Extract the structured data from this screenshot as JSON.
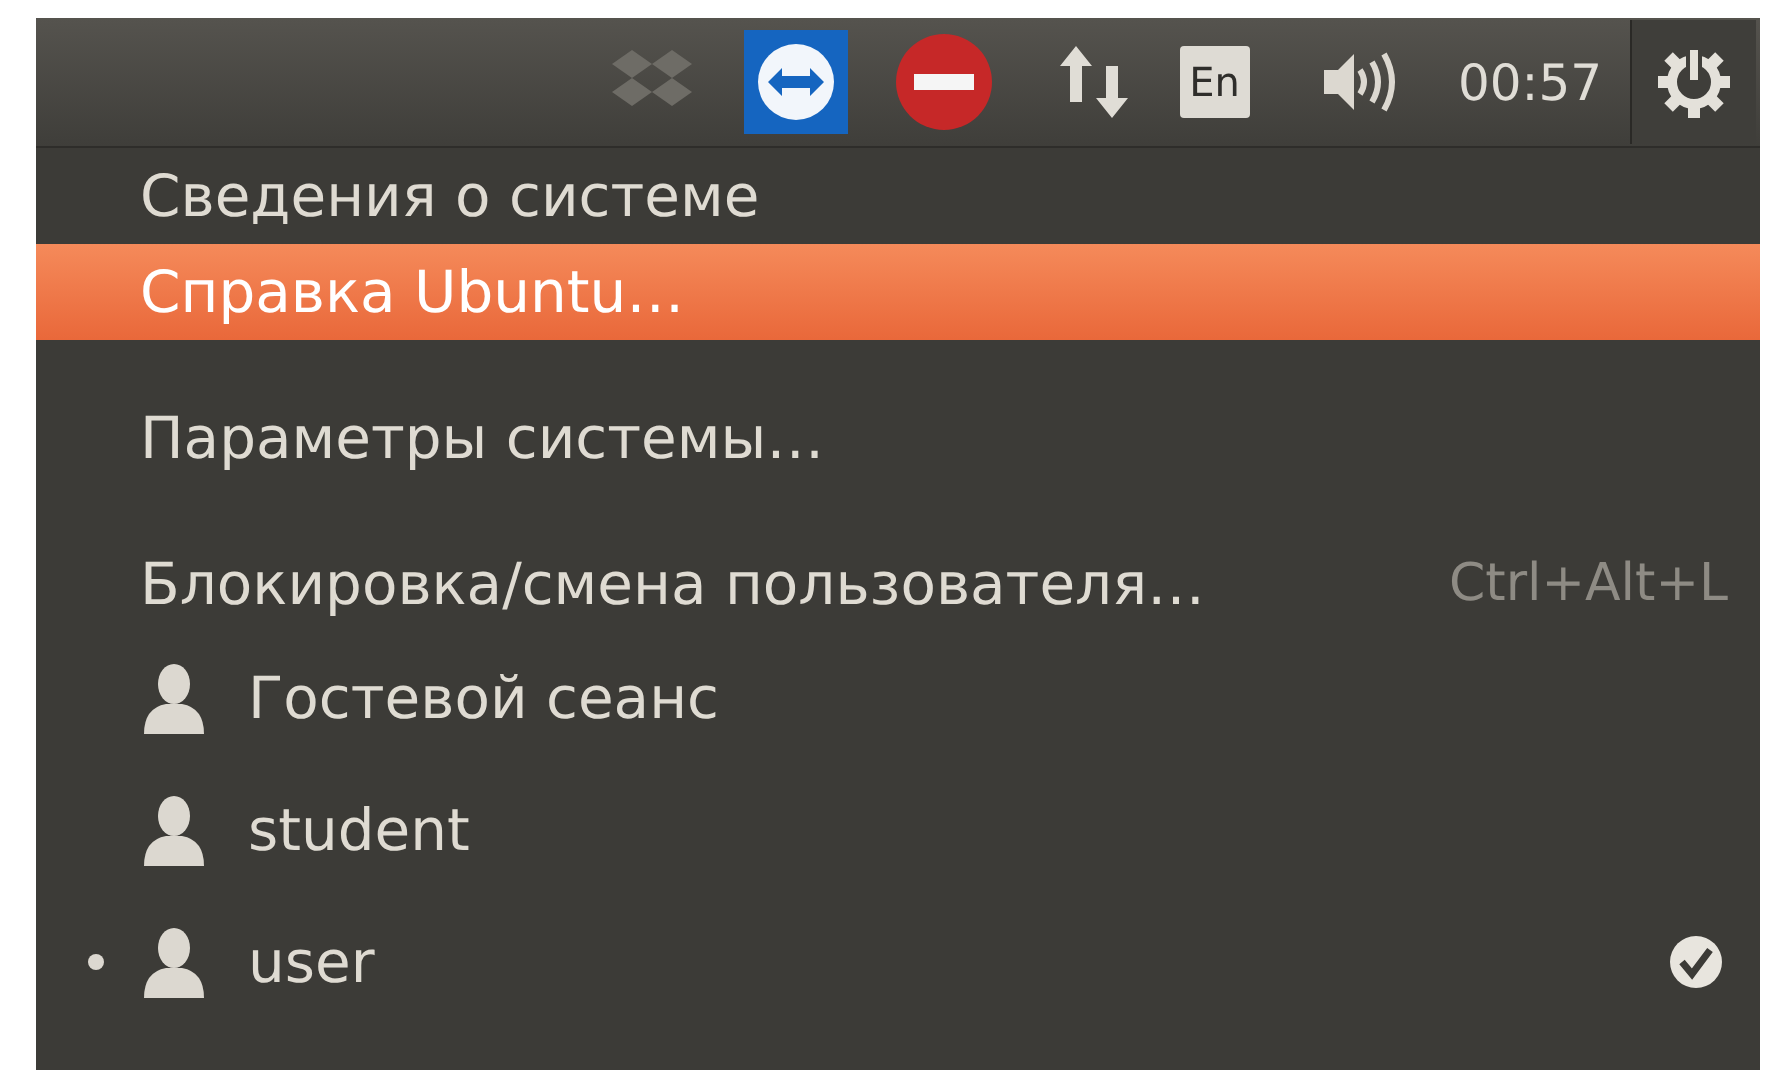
{
  "panel": {
    "indicators": [
      {
        "kind": "dropbox"
      },
      {
        "kind": "teamviewer"
      },
      {
        "kind": "stop"
      },
      {
        "kind": "network"
      },
      {
        "kind": "keyboard",
        "label": "En"
      },
      {
        "kind": "sound"
      },
      {
        "kind": "clock",
        "label": "00:57"
      }
    ],
    "session_button": {
      "open": true
    }
  },
  "menu": {
    "items": [
      {
        "kind": "item",
        "label": "Сведения о системе",
        "selected": false
      },
      {
        "kind": "item",
        "label": "Справка Ubuntu…",
        "selected": true
      },
      {
        "kind": "gap"
      },
      {
        "kind": "item",
        "label": "Параметры системы…",
        "selected": false
      },
      {
        "kind": "gap"
      },
      {
        "kind": "item",
        "label": "Блокировка/смена пользователя…",
        "shortcut": "Ctrl+Alt+L",
        "selected": false
      },
      {
        "kind": "user",
        "label": "Гостевой сеанс",
        "current": false,
        "checked": false,
        "selected": false
      },
      {
        "kind": "user",
        "label": "student",
        "current": false,
        "checked": false,
        "selected": false
      },
      {
        "kind": "user",
        "label": "user",
        "current": true,
        "checked": true,
        "selected": false
      }
    ]
  }
}
